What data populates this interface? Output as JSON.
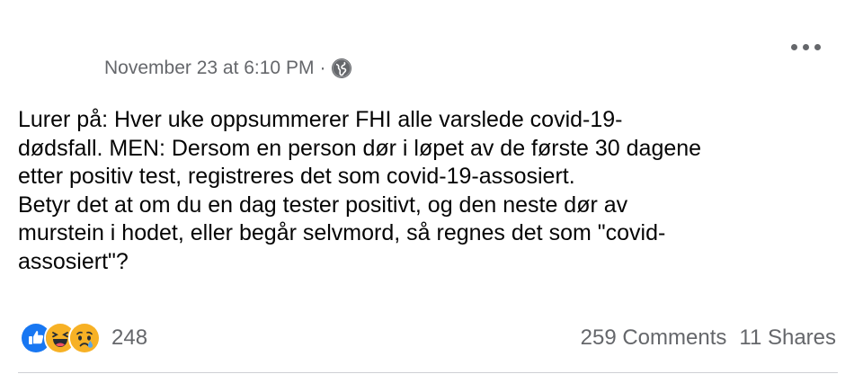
{
  "post": {
    "timestamp": "November 23 at 6:10 PM",
    "separator": "·",
    "audience_icon": "globe-icon",
    "more_icon": "more-options-icon",
    "text_lines": [
      "Lurer på: Hver uke oppsummerer FHI alle varslede covid-19-",
      "dødsfall. MEN: Dersom en person dør i løpet av de første 30 dagene",
      "etter positiv test, registreres det som covid-19-assosiert.",
      "Betyr det at om du en dag tester positivt, og den neste dør av",
      "murstein i hodet, eller begår selvmord, så regnes det som \"covid-",
      "assosiert\"?"
    ]
  },
  "reactions": {
    "icons": [
      "like-reaction-icon",
      "haha-reaction-icon",
      "sad-reaction-icon"
    ],
    "count": "248"
  },
  "stats": {
    "comments": "259 Comments",
    "shares": "11 Shares"
  },
  "colors": {
    "secondary_text": "#65676b",
    "primary_text": "#050505",
    "like_blue": "#1877f2",
    "emoji_yellow": "#f7b125",
    "divider": "#ced0d4"
  }
}
